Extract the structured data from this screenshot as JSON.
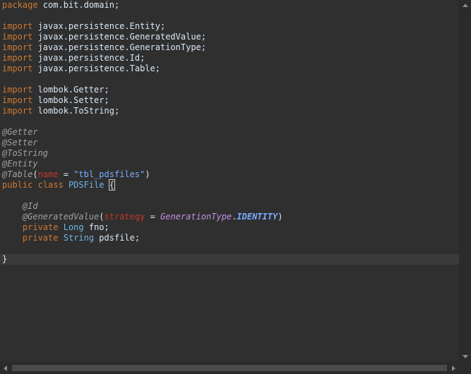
{
  "editor": {
    "lines": {
      "l1": {
        "kw": "package",
        "rest": " com.bit.domain;"
      },
      "l3": {
        "kw": "import",
        "rest": " javax.persistence.Entity;"
      },
      "l4": {
        "kw": "import",
        "rest": " javax.persistence.GeneratedValue;"
      },
      "l5": {
        "kw": "import",
        "rest": " javax.persistence.GenerationType;"
      },
      "l6": {
        "kw": "import",
        "rest": " javax.persistence.Id;"
      },
      "l7": {
        "kw": "import",
        "rest": " javax.persistence.Table;"
      },
      "l9": {
        "kw": "import",
        "rest": " lombok.Getter;"
      },
      "l10": {
        "kw": "import",
        "rest": " lombok.Setter;"
      },
      "l11": {
        "kw": "import",
        "rest": " lombok.ToString;"
      },
      "l13": {
        "ann": "@Getter"
      },
      "l14": {
        "ann": "@Setter"
      },
      "l15": {
        "ann": "@ToString"
      },
      "l16": {
        "ann": "@Entity"
      },
      "l17": {
        "ann": "@Table",
        "open": "(",
        "param": "name",
        "eq": " = ",
        "str": "\"tbl_pdsfiles\"",
        "close": ")"
      },
      "l18": {
        "kw1": "public",
        "kw2": " class",
        "sp": " ",
        "type": "PDSFile",
        "sp2": " ",
        "brace": "{"
      },
      "l20": {
        "indent": "    ",
        "ann": "@Id"
      },
      "l21": {
        "indent": "    ",
        "ann": "@GeneratedValue",
        "open": "(",
        "param": "strategy",
        "eq": " = ",
        "enum": "GenerationType",
        "dot": ".",
        "const": "IDENTITY",
        "close": ")"
      },
      "l22": {
        "indent": "    ",
        "kw": "private",
        "sp": " ",
        "type": "Long",
        "rest": " fno;"
      },
      "l23": {
        "indent": "    ",
        "kw": "private",
        "sp": " ",
        "type": "String",
        "rest": " pdsfile;"
      },
      "l25": {
        "brace": "}"
      }
    }
  },
  "colors": {
    "background": "#2f2f2f",
    "keyword": "#cc7832",
    "annotation": "#a0a0a0",
    "type": "#6fb4e6",
    "string": "#79abff",
    "parameter": "#c0392b"
  }
}
